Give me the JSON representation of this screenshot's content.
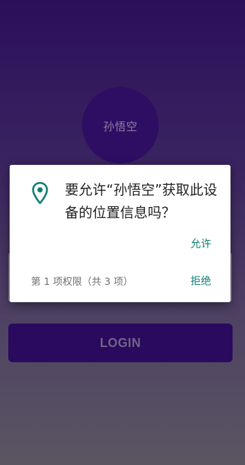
{
  "avatar": {
    "label": "孙悟空"
  },
  "login": {
    "label": "LOGIN"
  },
  "dialog": {
    "icon": "location-pin-icon",
    "message": "要允许“孙悟空”获取此设备的位置信息吗？",
    "allow_label": "允许",
    "counter": "第 1 项权限（共 3 项）",
    "deny_label": "拒绝"
  },
  "colors": {
    "accent": "#0f7d74",
    "button": "#2a0a5e",
    "avatar": "#2d0e63"
  }
}
